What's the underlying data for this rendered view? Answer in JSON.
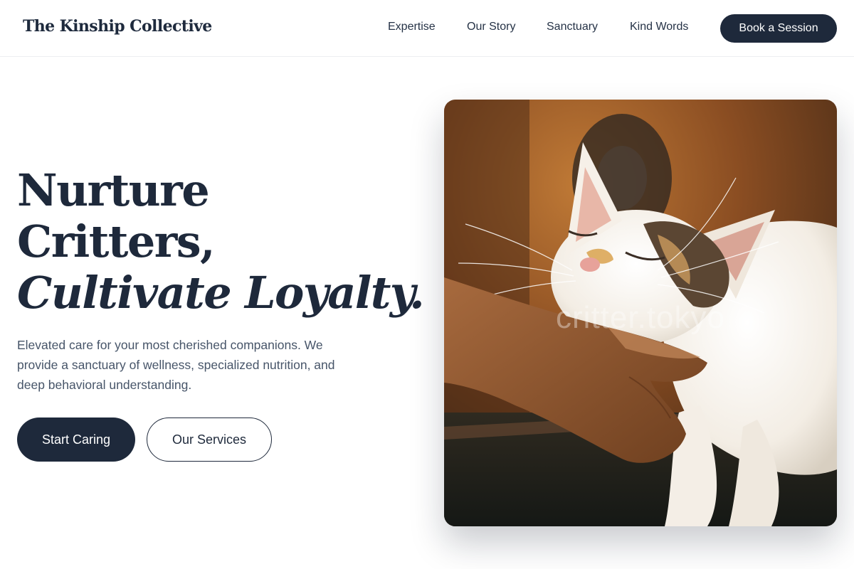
{
  "header": {
    "logo": "The Kinship Collective",
    "nav": [
      "Expertise",
      "Our Story",
      "Sanctuary",
      "Kind Words"
    ],
    "cta": "Book a Session"
  },
  "hero": {
    "title_line1": "Nurture",
    "title_line2": "Critters,",
    "title_line3": "Cultivate Loyalty.",
    "subtitle": "Elevated care for your most cherished companions. We provide a sanctuary of wellness, specialized nutrition, and deep behavioral understanding.",
    "primary_button": "Start Caring",
    "secondary_button": "Our Services"
  },
  "photo": {
    "watermark": "critter.tokyo"
  },
  "colors": {
    "primary": "#1e293b",
    "text_muted": "#475569",
    "background": "#ffffff"
  }
}
